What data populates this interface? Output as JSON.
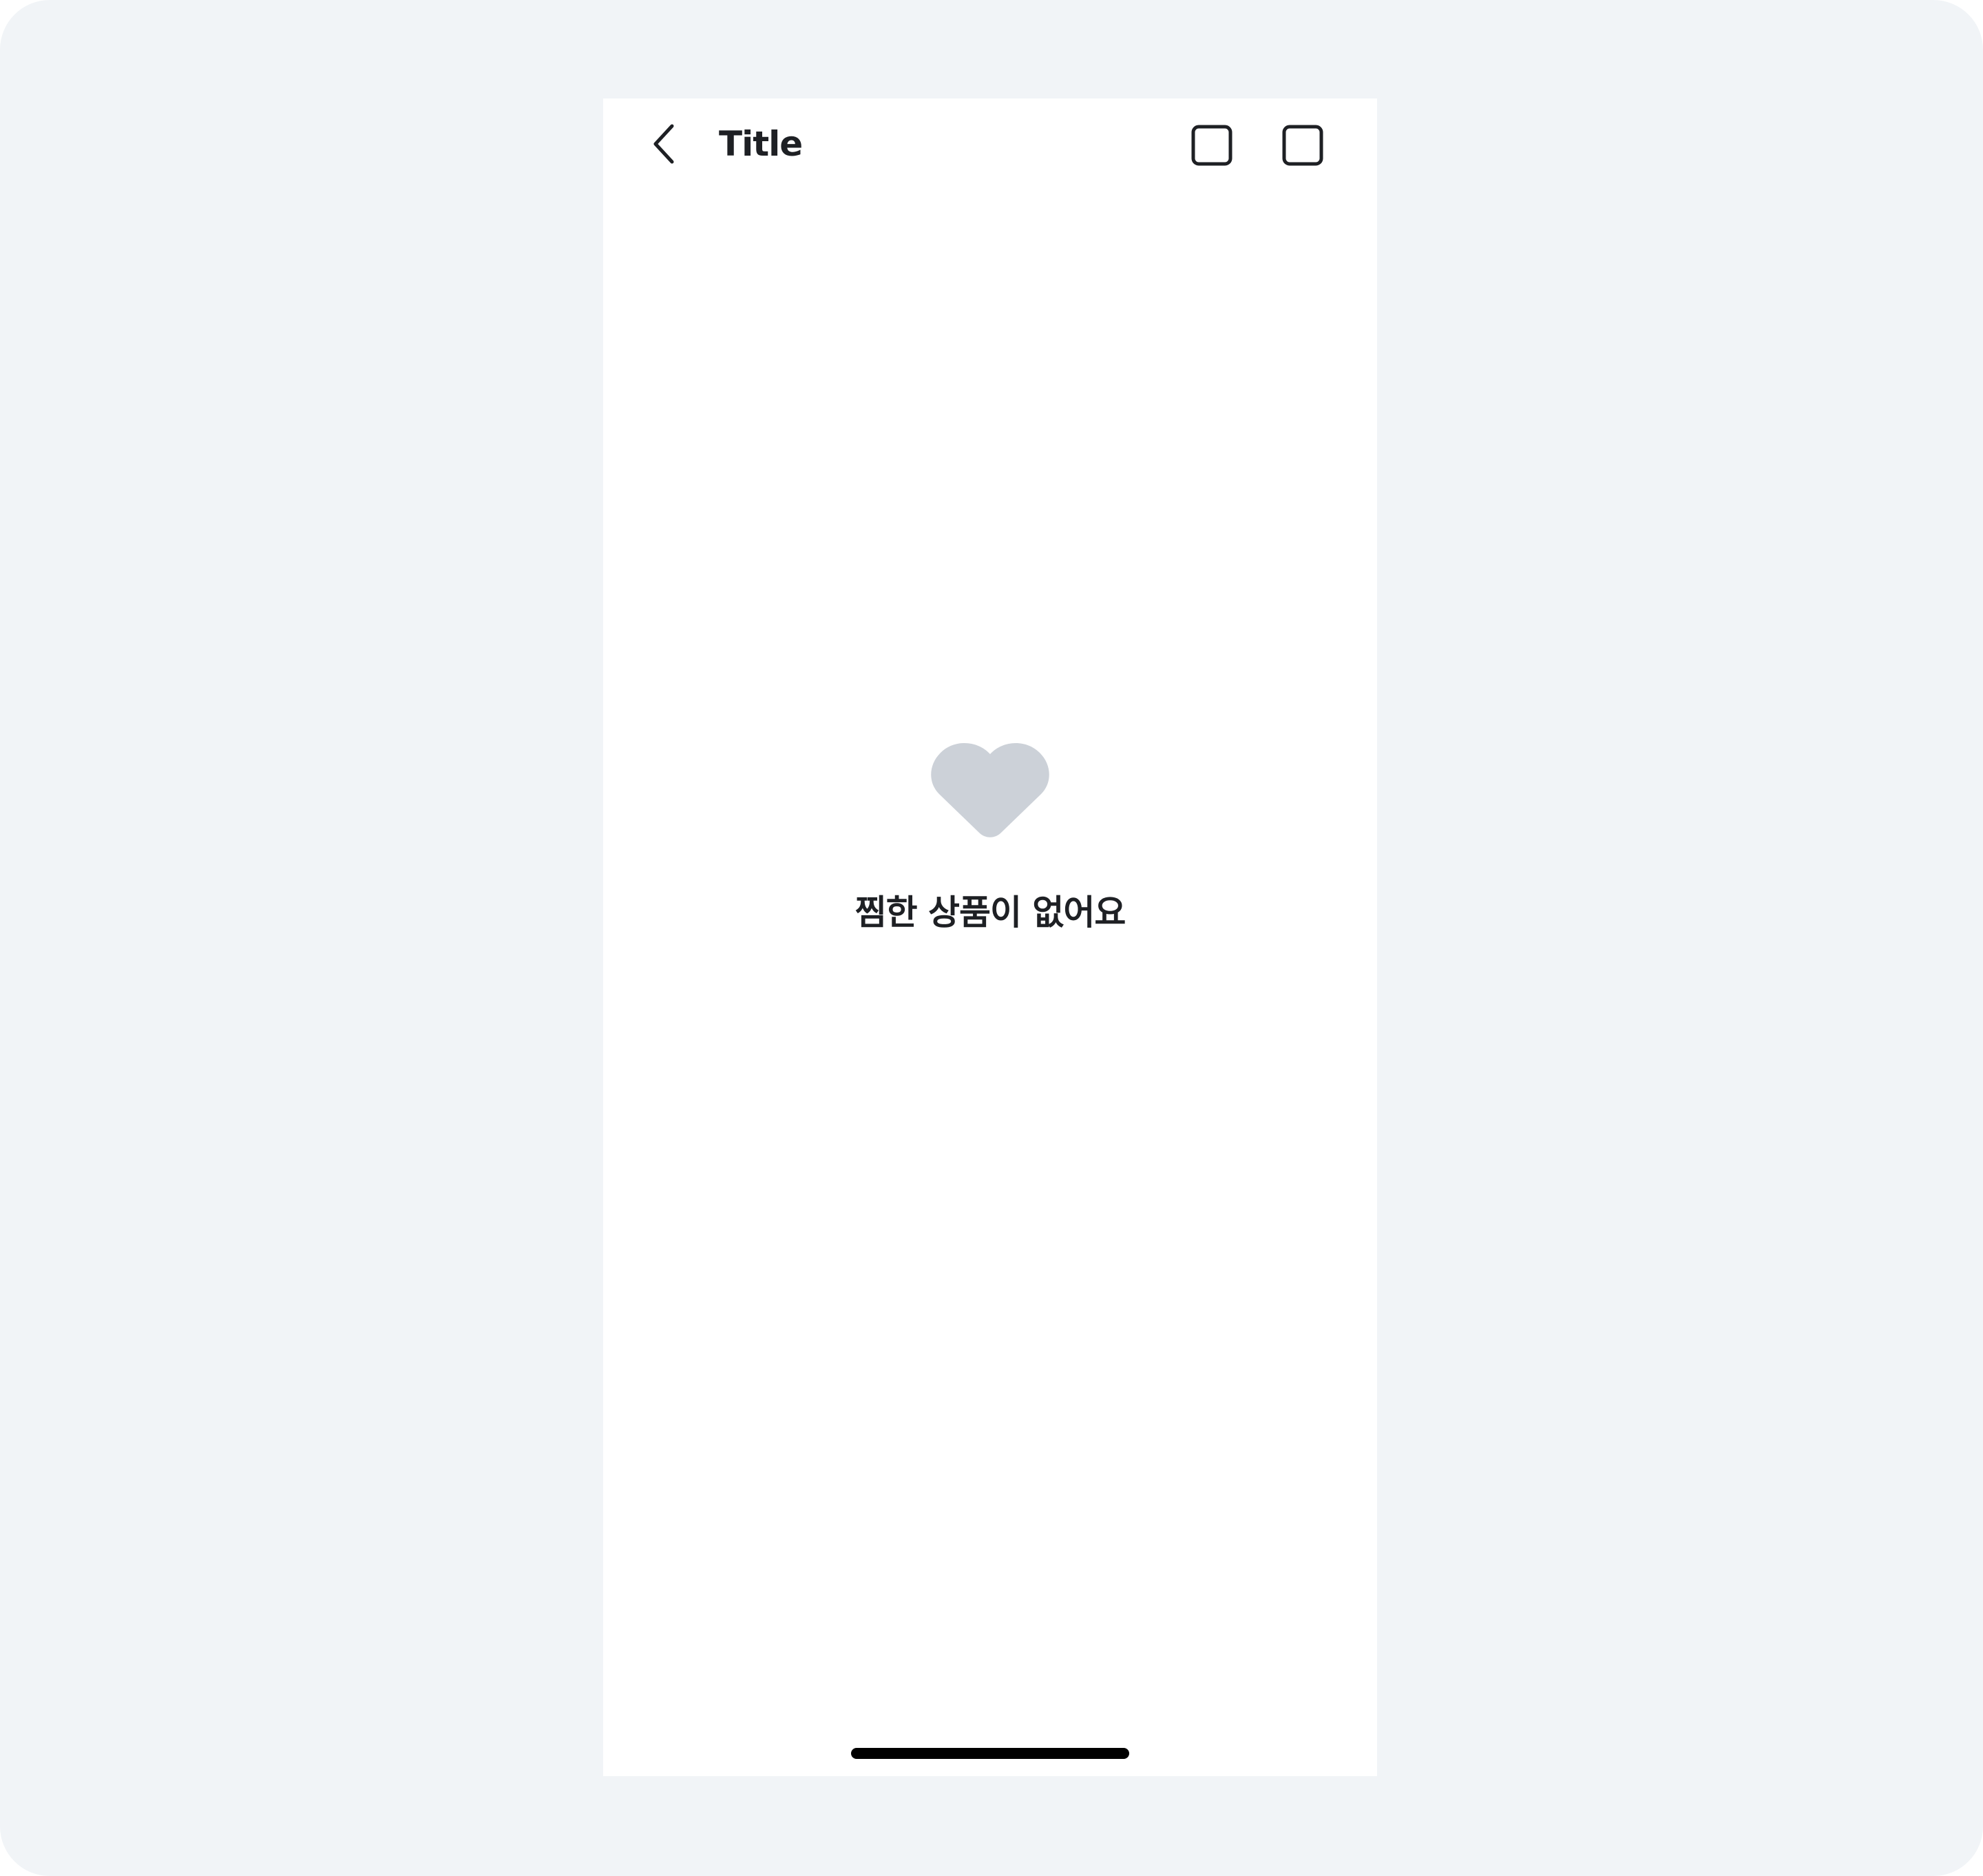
{
  "header": {
    "title": "Title",
    "back_icon": "chevron-left-icon",
    "actions": [
      {
        "icon": "square-icon"
      },
      {
        "icon": "square-icon"
      }
    ]
  },
  "empty_state": {
    "icon": "heart-icon",
    "message": "찜한 상품이 없어요"
  },
  "colors": {
    "background": "#f1f4f7",
    "surface": "#ffffff",
    "text": "#1e2024",
    "heart": "#ccd1d8",
    "home_indicator": "#000000"
  }
}
